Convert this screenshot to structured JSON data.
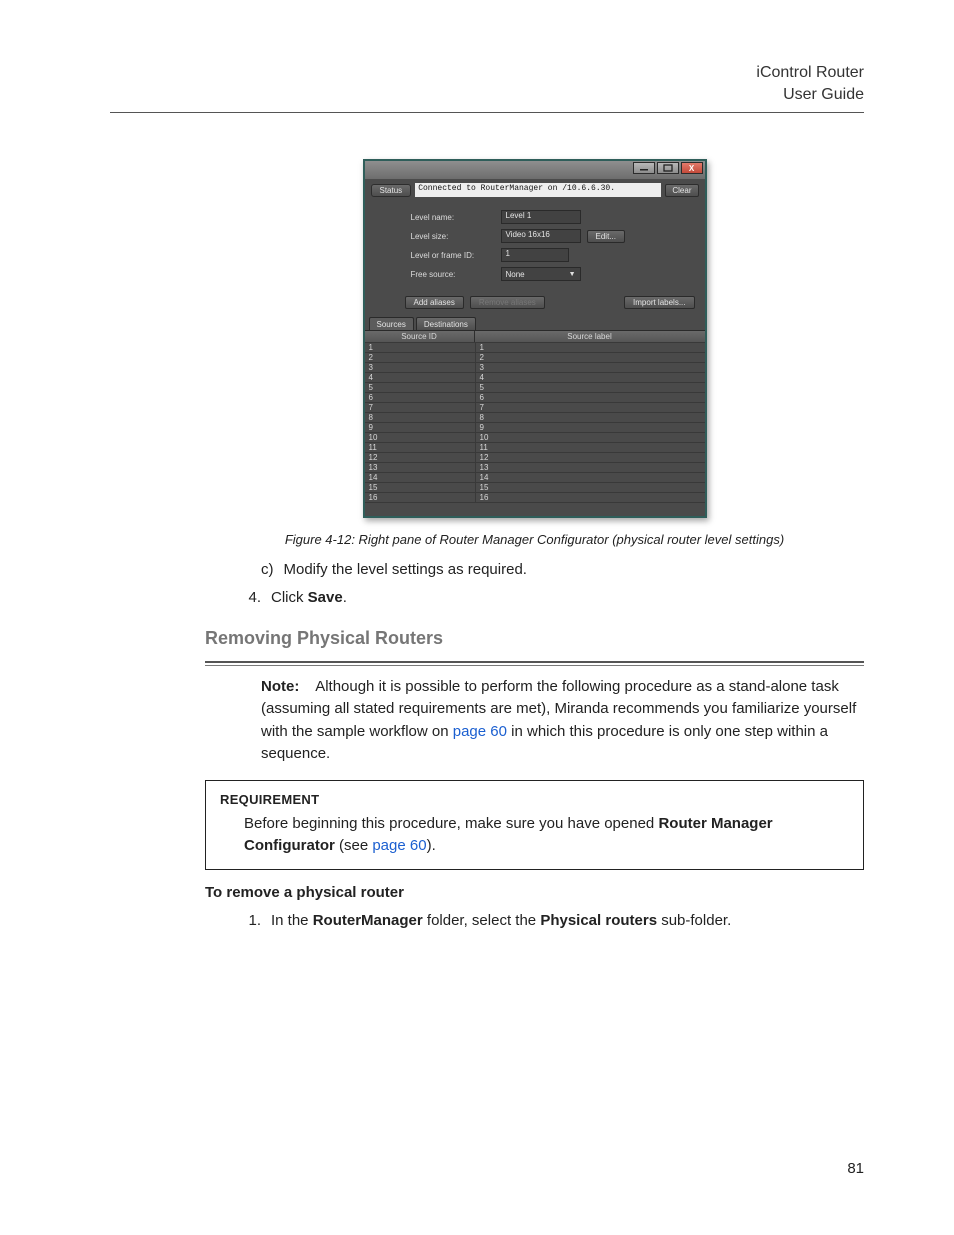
{
  "header": {
    "line1": "iControl Router",
    "line2": "User Guide"
  },
  "page_number": "81",
  "window": {
    "buttons": {
      "close_glyph": "X"
    },
    "status_label": "Status",
    "status_text": "Connected to RouterManager on /10.6.6.30.",
    "clear_label": "Clear",
    "form": {
      "level_name_label": "Level name:",
      "level_name_value": "Level 1",
      "level_size_label": "Level size:",
      "level_size_value": "Video 16x16",
      "edit_label": "Edit...",
      "level_id_label": "Level or frame ID:",
      "level_id_value": "1",
      "free_source_label": "Free source:",
      "free_source_value": "None"
    },
    "buttons_row": {
      "add_aliases": "Add aliases",
      "remove_aliases": "Remove aliases",
      "import_labels": "Import labels..."
    },
    "tabs": {
      "sources": "Sources",
      "destinations": "Destinations"
    },
    "grid": {
      "col_id": "Source ID",
      "col_label": "Source label",
      "rows": [
        {
          "id": "1",
          "label": "1"
        },
        {
          "id": "2",
          "label": "2"
        },
        {
          "id": "3",
          "label": "3"
        },
        {
          "id": "4",
          "label": "4"
        },
        {
          "id": "5",
          "label": "5"
        },
        {
          "id": "6",
          "label": "6"
        },
        {
          "id": "7",
          "label": "7"
        },
        {
          "id": "8",
          "label": "8"
        },
        {
          "id": "9",
          "label": "9"
        },
        {
          "id": "10",
          "label": "10"
        },
        {
          "id": "11",
          "label": "11"
        },
        {
          "id": "12",
          "label": "12"
        },
        {
          "id": "13",
          "label": "13"
        },
        {
          "id": "14",
          "label": "14"
        },
        {
          "id": "15",
          "label": "15"
        },
        {
          "id": "16",
          "label": "16"
        }
      ]
    }
  },
  "figure_caption": "Figure 4-12:  Right pane of Router Manager Configurator (physical router level settings)",
  "steps": {
    "c_letter": "c)",
    "c_text": "Modify the level settings as required.",
    "s4_num": "4.",
    "s4_a": "Click ",
    "s4_b": "Save",
    "s4_c": "."
  },
  "section_heading": "Removing Physical Routers",
  "note": {
    "label": "Note:",
    "t1": "Although it is possible to perform the following procedure as a stand-alone task (assuming all stated requirements are met), Miranda recommends you familiarize yourself with the sample workflow on ",
    "link": "page 60",
    "t2": " in which this procedure is only one step within a sequence."
  },
  "requirement": {
    "title": "REQUIREMENT",
    "t1": "Before beginning this procedure, make sure you have opened ",
    "bold": "Router Manager Configurator",
    "t2": " (see ",
    "link": "page 60",
    "t3": ")."
  },
  "sub_heading": "To remove a physical router",
  "step1": {
    "num": "1.",
    "a": "In the ",
    "b1": "RouterManager",
    "c": " folder, select the ",
    "b2": "Physical routers",
    "d": " sub-folder."
  }
}
